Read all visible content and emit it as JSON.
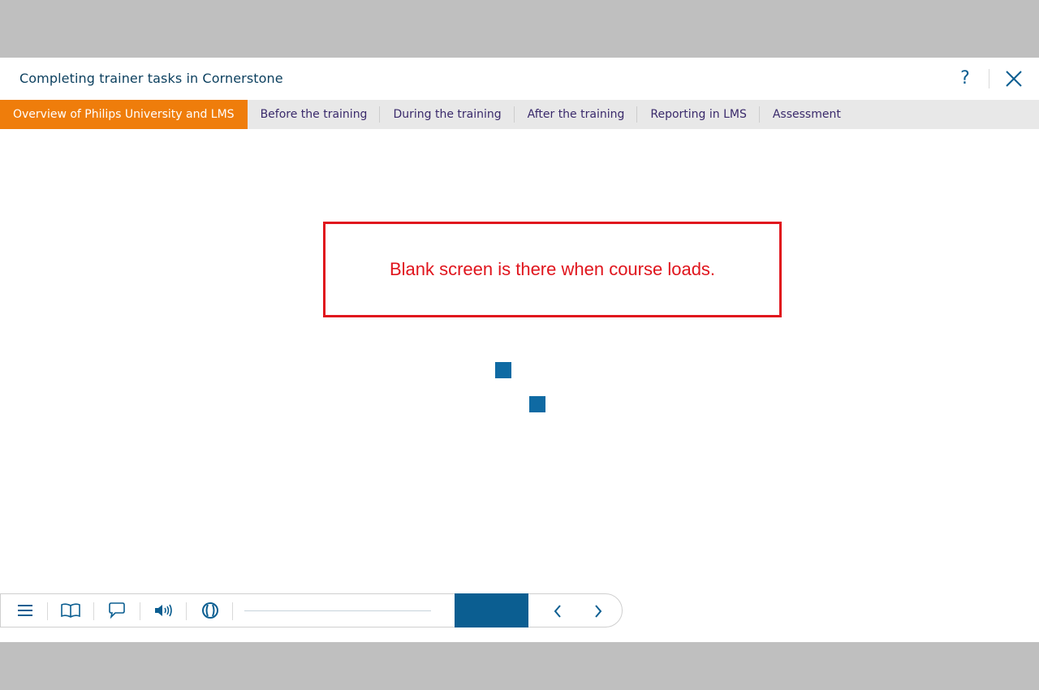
{
  "header": {
    "title": "Completing trainer tasks in Cornerstone",
    "help_label": "?"
  },
  "tabs": [
    {
      "label": "Overview of Philips University and LMS",
      "active": true
    },
    {
      "label": "Before the training",
      "active": false
    },
    {
      "label": "During the training",
      "active": false
    },
    {
      "label": "After the training",
      "active": false
    },
    {
      "label": "Reporting in LMS",
      "active": false
    },
    {
      "label": "Assessment",
      "active": false
    }
  ],
  "notice": {
    "text": "Blank screen is there when course loads.",
    "color": "#e0151d"
  },
  "toolbar": {
    "icons": [
      "menu-icon",
      "glossary-book-icon",
      "comment-icon",
      "audio-icon",
      "captions-icon"
    ],
    "progress": 0,
    "primary_button_label": ""
  },
  "colors": {
    "accent": "#ef7d0b",
    "brand": "#0b5e91",
    "loader": "#0f6aa3"
  }
}
